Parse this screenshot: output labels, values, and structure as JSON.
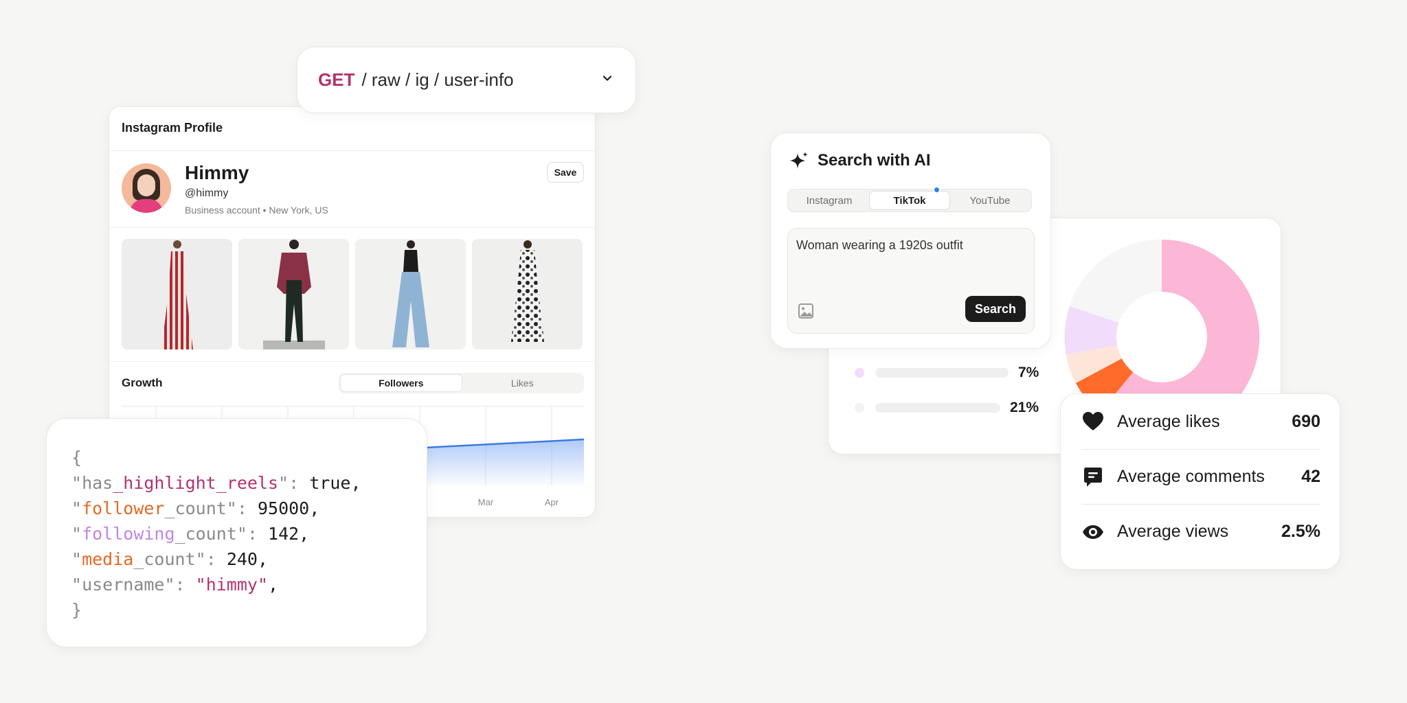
{
  "endpoint": {
    "method": "GET",
    "path": "/ raw / ig / user-info",
    "icon": "chevron-down-icon"
  },
  "profile": {
    "header": "Instagram Profile",
    "name": "Himmy",
    "handle": "@himmy",
    "meta": "Business account • New York, US",
    "save_label": "Save",
    "photos": [
      {
        "description": "red striped dress"
      },
      {
        "description": "burgundy jacket outfit"
      },
      {
        "description": "black top with wide jeans"
      },
      {
        "description": "floral print dress"
      }
    ],
    "growth": {
      "title": "Growth",
      "tabs": [
        "Followers",
        "Likes"
      ],
      "active_tab": "Followers",
      "x_labels": [
        "Mar",
        "Apr"
      ]
    }
  },
  "json_snippet": {
    "open": "{",
    "close": "}",
    "lines": [
      {
        "key_pre": "has",
        "key_hl": "_highlight_reels",
        "key_post": "",
        "value": "true"
      },
      {
        "key_pre": "",
        "key_hl": "follower",
        "key_post": "_count",
        "value": "95000"
      },
      {
        "key_pre": "",
        "key_hl": "following",
        "key_post": "_count",
        "value": "142"
      },
      {
        "key_pre": "",
        "key_hl": "media",
        "key_post": "_count",
        "value": "240"
      },
      {
        "key_pre": "username",
        "key_hl": "",
        "key_post": "",
        "value": "\"himmy\""
      }
    ]
  },
  "search_ai": {
    "title": "Search with AI",
    "tabs": [
      "Instagram",
      "TikTok",
      "YouTube"
    ],
    "active_tab": "TikTok",
    "prompt": "Woman wearing a 1920s outfit",
    "button": "Search"
  },
  "donut": {
    "legend": [
      {
        "value": "7%",
        "color": "#f2dcfb"
      },
      {
        "value": "21%",
        "color": "#f6f6f6"
      }
    ]
  },
  "stats": [
    {
      "icon": "heart-icon",
      "label": "Average likes",
      "value": "690"
    },
    {
      "icon": "comment-icon",
      "label": "Average comments",
      "value": "42"
    },
    {
      "icon": "eye-icon",
      "label": "Average views",
      "value": "2.5%"
    }
  ],
  "colors": {
    "accent_magenta": "#b3326f",
    "accent_orange": "#e26a24",
    "accent_lavender": "#c084e8",
    "chart_line": "#3b7be0",
    "donut_pink": "#fcb6d6",
    "donut_orange": "#ff6b2b"
  }
}
